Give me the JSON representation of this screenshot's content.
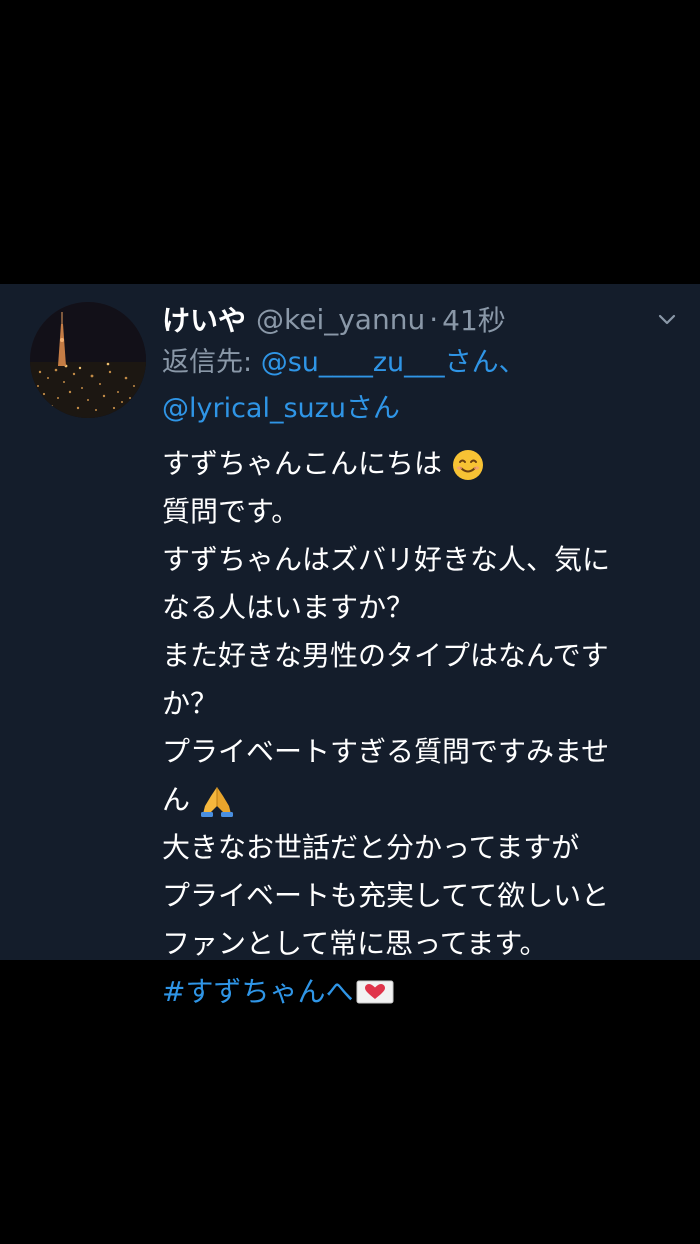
{
  "tweet": {
    "display_name": "けいや",
    "handle": "@kei_yannu",
    "separator": "·",
    "time": "41秒",
    "reply_prefix": "返信先: ",
    "reply_mention_1": "@su____zu___さん、",
    "reply_mention_2": "@lyrical_suzuさん",
    "lines": [
      "すずちゃんこんにちは",
      "質問です。",
      "すずちゃんはズバリ好きな人、気に",
      "なる人はいますか？",
      "また好きな男性のタイプはなんです",
      "か？",
      "プライベートすぎる質問ですみませ",
      "ん",
      "大きなお世話だと分かってますが",
      "プライベートも充実してて欲しいと",
      "ファンとして常に思ってます。"
    ],
    "hashtag": "#すずちゃんへ",
    "emojis": {
      "line1": "smiling-face-emoji",
      "line8": "folded-hands-emoji",
      "hashtag": "love-letter-emoji"
    }
  },
  "colors": {
    "background": "#000000",
    "card": "#141d2b",
    "text": "#ffffff",
    "secondary": "#8a98a8",
    "link": "#2f95e6"
  },
  "icons": {
    "menu": "chevron-down-icon"
  }
}
